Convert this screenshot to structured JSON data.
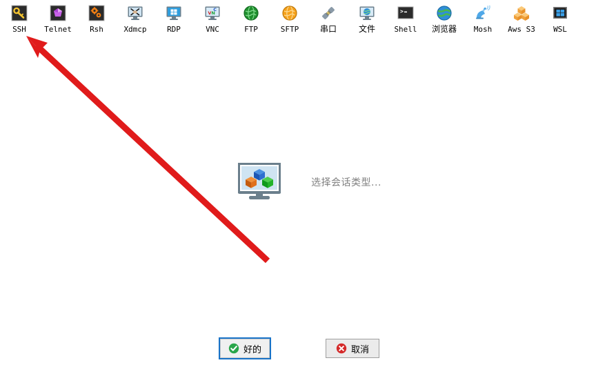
{
  "dialog": {
    "session_toolbar": {
      "items": [
        {
          "label": "SSH",
          "icon": "ssh-key-icon",
          "cjk": false
        },
        {
          "label": "Telnet",
          "icon": "telnet-gem-icon",
          "cjk": false
        },
        {
          "label": "Rsh",
          "icon": "rsh-gears-icon",
          "cjk": false
        },
        {
          "label": "Xdmcp",
          "icon": "xdmcp-monitor-icon",
          "cjk": false
        },
        {
          "label": "RDP",
          "icon": "rdp-windows-icon",
          "cjk": false
        },
        {
          "label": "VNC",
          "icon": "vnc-monitor-icon",
          "cjk": false
        },
        {
          "label": "FTP",
          "icon": "ftp-globe-icon",
          "cjk": false
        },
        {
          "label": "SFTP",
          "icon": "sftp-globe-icon",
          "cjk": false
        },
        {
          "label": "串口",
          "icon": "serial-plug-icon",
          "cjk": true
        },
        {
          "label": "文件",
          "icon": "file-monitor-icon",
          "cjk": true
        },
        {
          "label": "Shell",
          "icon": "shell-terminal-icon",
          "cjk": false
        },
        {
          "label": "浏览器",
          "icon": "browser-globe-icon",
          "cjk": true
        },
        {
          "label": "Mosh",
          "icon": "mosh-satellite-icon",
          "cjk": false
        },
        {
          "label": "Aws S3",
          "icon": "aws-s3-cubes-icon",
          "cjk": false
        },
        {
          "label": "WSL",
          "icon": "wsl-windows-icon",
          "cjk": false
        }
      ]
    },
    "center": {
      "placeholder_icon": "monitor-cubes-icon",
      "placeholder_text": "选择会话类型..."
    },
    "buttons": {
      "ok": {
        "label": "好的",
        "icon": "green-check-icon"
      },
      "cancel": {
        "label": "取消",
        "icon": "red-cross-icon"
      }
    },
    "annotation": {
      "arrow_color": "#e01b1b",
      "arrow_tip": "38,52",
      "arrow_tail": "388,378",
      "points_at": "SSH"
    }
  },
  "colors": {
    "accent_focus": "#1873c8",
    "ok_icon": "#2aa64a",
    "cancel_icon": "#d42a2a",
    "placeholder_text": "#818181",
    "arrow": "#e01b1b"
  }
}
